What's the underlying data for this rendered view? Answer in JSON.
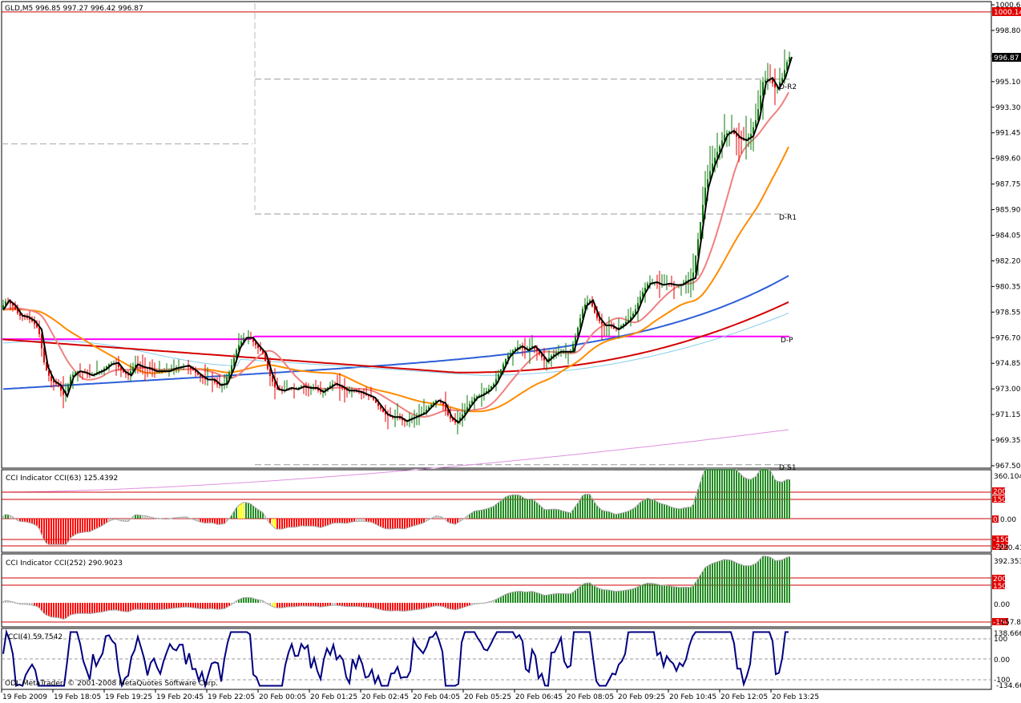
{
  "window": {
    "symbol_line": "GLD,M5  996.85 997.27 996.42 996.87"
  },
  "colors": {
    "background": "#ffffff",
    "frame": "#000000",
    "bull": "#0b7a0b",
    "bear": "#e60000",
    "close_line": "#000000",
    "ma_fast": "#f08080",
    "ma_mid": "#ff8c00",
    "ma_slow": "#d40000",
    "ma_blue": "#2c5fd8",
    "ma_lightblue": "#87ceeb",
    "pivot": "#ff00ff",
    "cci_pos": "#228b22",
    "cci_neg": "#ff0000",
    "cci_extreme": "#ffff00",
    "cci4_line": "#000080",
    "level_line": "#d00000",
    "tag_red": "#e00000"
  },
  "price_axis": {
    "ticks": [
      "1000.65",
      "998.80",
      "996.95",
      "995.10",
      "993.30",
      "991.45",
      "989.60",
      "987.75",
      "985.90",
      "984.05",
      "982.20",
      "980.35",
      "978.55",
      "976.70",
      "974.85",
      "973.00",
      "971.15",
      "969.35",
      "967.50"
    ],
    "last_price_tag": "996.87",
    "top_line_tag": "1000.14"
  },
  "pivot_labels": {
    "r2": "D-R2",
    "r1": "D-R1",
    "p": "D-P",
    "s1": "D-S1"
  },
  "panels": {
    "cci63": {
      "title": "CCI Indicator  CCI(63) 125.4392",
      "axis_top": "360.1046",
      "axis_zero": "0.00",
      "axis_bottom": "-230.411",
      "tags": [
        "200",
        "150",
        "0",
        "-150",
        "-200"
      ]
    },
    "cci252": {
      "title": "CCI Indicator  CCI(252) 290.9023",
      "axis_top": "392.3535",
      "axis_zero": "0.00",
      "axis_bottom": "-157.825",
      "tags": [
        "200",
        "150",
        "-150"
      ]
    },
    "cci4": {
      "title": "CCI(4) 59.7542",
      "axis_top": "138.666",
      "axis_100": "100",
      "axis_zero": "0.00",
      "axis_m100": "-100",
      "axis_bottom": "-134.666",
      "watermark": "ODL MetaTrader, © 2001-2008 MetaQuotes Software Corp."
    }
  },
  "time_axis": [
    "19 Feb 2009",
    "19 Feb 18:05",
    "19 Feb 19:25",
    "19 Feb 20:45",
    "19 Feb 22:05",
    "20 Feb 00:05",
    "20 Feb 01:25",
    "20 Feb 02:45",
    "20 Feb 04:05",
    "20 Feb 05:25",
    "20 Feb 06:45",
    "20 Feb 08:05",
    "20 Feb 09:25",
    "20 Feb 10:45",
    "20 Feb 12:05",
    "20 Feb 13:25"
  ],
  "chart_data": {
    "type": "line",
    "symbol": "GLD",
    "timeframe": "M5",
    "ohlc_last": {
      "open": 996.85,
      "high": 997.27,
      "low": 996.42,
      "close": 996.87
    },
    "close_path": [
      [
        0,
        978.7
      ],
      [
        8,
        979.4
      ],
      [
        16,
        979.0
      ],
      [
        24,
        978.3
      ],
      [
        32,
        978.2
      ],
      [
        40,
        977.9
      ],
      [
        48,
        977.3
      ],
      [
        56,
        974.6
      ],
      [
        64,
        973.6
      ],
      [
        72,
        973.3
      ],
      [
        80,
        972.5
      ],
      [
        88,
        973.9
      ],
      [
        96,
        974.3
      ],
      [
        104,
        974.2
      ],
      [
        112,
        974.0
      ],
      [
        120,
        974.2
      ],
      [
        128,
        974.4
      ],
      [
        136,
        974.8
      ],
      [
        144,
        974.9
      ],
      [
        152,
        974.3
      ],
      [
        160,
        974.0
      ],
      [
        168,
        974.8
      ],
      [
        176,
        974.6
      ],
      [
        184,
        974.5
      ],
      [
        192,
        974.3
      ],
      [
        200,
        974.3
      ],
      [
        208,
        974.3
      ],
      [
        216,
        974.5
      ],
      [
        224,
        974.6
      ],
      [
        232,
        974.7
      ],
      [
        240,
        974.4
      ],
      [
        248,
        974.0
      ],
      [
        256,
        973.7
      ],
      [
        264,
        973.7
      ],
      [
        272,
        973.3
      ],
      [
        280,
        973.4
      ],
      [
        288,
        974.5
      ],
      [
        296,
        976.0
      ],
      [
        304,
        976.7
      ],
      [
        312,
        976.7
      ],
      [
        320,
        976.1
      ],
      [
        328,
        975.6
      ],
      [
        336,
        974.1
      ],
      [
        344,
        973.0
      ],
      [
        352,
        972.9
      ],
      [
        360,
        973.1
      ],
      [
        368,
        973.0
      ],
      [
        376,
        973.2
      ],
      [
        384,
        973.1
      ],
      [
        392,
        973.1
      ],
      [
        400,
        972.8
      ],
      [
        408,
        973.1
      ],
      [
        416,
        973.4
      ],
      [
        424,
        973.2
      ],
      [
        432,
        972.9
      ],
      [
        440,
        972.9
      ],
      [
        448,
        972.8
      ],
      [
        456,
        972.6
      ],
      [
        464,
        972.4
      ],
      [
        472,
        971.8
      ],
      [
        480,
        971.2
      ],
      [
        488,
        971.0
      ],
      [
        496,
        971.0
      ],
      [
        504,
        970.7
      ],
      [
        512,
        970.9
      ],
      [
        520,
        971.1
      ],
      [
        528,
        971.3
      ],
      [
        536,
        971.8
      ],
      [
        544,
        972.2
      ],
      [
        552,
        972.0
      ],
      [
        560,
        971.0
      ],
      [
        568,
        970.6
      ],
      [
        576,
        971.1
      ],
      [
        584,
        971.8
      ],
      [
        592,
        972.4
      ],
      [
        600,
        972.6
      ],
      [
        608,
        972.9
      ],
      [
        616,
        973.4
      ],
      [
        624,
        974.3
      ],
      [
        632,
        975.3
      ],
      [
        640,
        975.8
      ],
      [
        648,
        976.1
      ],
      [
        656,
        975.8
      ],
      [
        664,
        976.1
      ],
      [
        672,
        975.6
      ],
      [
        680,
        975.0
      ],
      [
        688,
        975.4
      ],
      [
        696,
        975.7
      ],
      [
        704,
        975.7
      ],
      [
        712,
        975.7
      ],
      [
        720,
        977.2
      ],
      [
        728,
        979.0
      ],
      [
        736,
        979.4
      ],
      [
        744,
        978.2
      ],
      [
        752,
        977.6
      ],
      [
        760,
        977.6
      ],
      [
        768,
        977.3
      ],
      [
        776,
        977.6
      ],
      [
        784,
        978.0
      ],
      [
        792,
        978.6
      ],
      [
        800,
        979.8
      ],
      [
        808,
        980.6
      ],
      [
        816,
        980.7
      ],
      [
        824,
        980.5
      ],
      [
        832,
        980.6
      ],
      [
        840,
        980.5
      ],
      [
        848,
        980.5
      ],
      [
        856,
        980.8
      ],
      [
        864,
        981.0
      ],
      [
        872,
        984.2
      ],
      [
        880,
        987.5
      ],
      [
        888,
        989.1
      ],
      [
        896,
        990.2
      ],
      [
        904,
        991.3
      ],
      [
        912,
        991.6
      ],
      [
        920,
        991.1
      ],
      [
        928,
        990.9
      ],
      [
        936,
        991.2
      ],
      [
        944,
        992.5
      ],
      [
        952,
        995.1
      ],
      [
        960,
        995.4
      ],
      [
        968,
        994.6
      ],
      [
        976,
        995.4
      ],
      [
        984,
        996.9
      ]
    ],
    "pivots": {
      "D-R2": 995.3,
      "D-R1": 985.6,
      "D-P": 976.8,
      "D-S1": 967.4
    },
    "cci63_last": 125.4392,
    "cci252_last": 290.9023,
    "cci4_last": 59.7542
  }
}
